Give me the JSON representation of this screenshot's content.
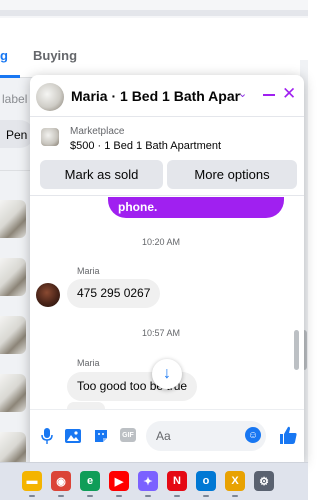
{
  "background": {
    "tabs": [
      {
        "label": "g",
        "active": true
      },
      {
        "label": "Buying",
        "active": false
      }
    ],
    "filter_label": "label",
    "pill_label": "Pen"
  },
  "chat": {
    "title": "Maria · 1 Bed 1 Bath Apart…",
    "listing": {
      "kind": "Marketplace",
      "title": "$500 · 1 Bed 1 Bath Apartment"
    },
    "buttons": {
      "mark_sold": "Mark as sold",
      "more_options": "More options"
    },
    "messages": {
      "outgoing_tail": "phone.",
      "time_1": "10:20 AM",
      "sender_1": "Maria",
      "text_1": "475 295 0267",
      "time_2": "10:57 AM",
      "sender_2": "Maria",
      "text_2": "Too good too be true"
    },
    "composer": {
      "placeholder": "Aa",
      "gif_label": "GIF"
    }
  },
  "colors": {
    "accent": "#a020f0",
    "facebook_blue": "#1877f2"
  },
  "taskbar": {
    "apps": [
      {
        "name": "file-explorer-icon",
        "glyph": "▬",
        "color": "#f4b400"
      },
      {
        "name": "chrome-icon",
        "glyph": "◉",
        "color": "#db4437"
      },
      {
        "name": "edge-icon",
        "glyph": "e",
        "color": "#0f9d58"
      },
      {
        "name": "youtube-icon",
        "glyph": "▶",
        "color": "#ff0000"
      },
      {
        "name": "copilot-icon",
        "glyph": "✦",
        "color": "#7b61ff"
      },
      {
        "name": "netflix-icon",
        "glyph": "N",
        "color": "#e50914"
      },
      {
        "name": "outlook-icon",
        "glyph": "o",
        "color": "#0078d4"
      },
      {
        "name": "xbox-icon",
        "glyph": "X",
        "color": "#e8a202"
      },
      {
        "name": "settings-icon",
        "glyph": "⚙",
        "color": "#5a6270"
      }
    ]
  }
}
